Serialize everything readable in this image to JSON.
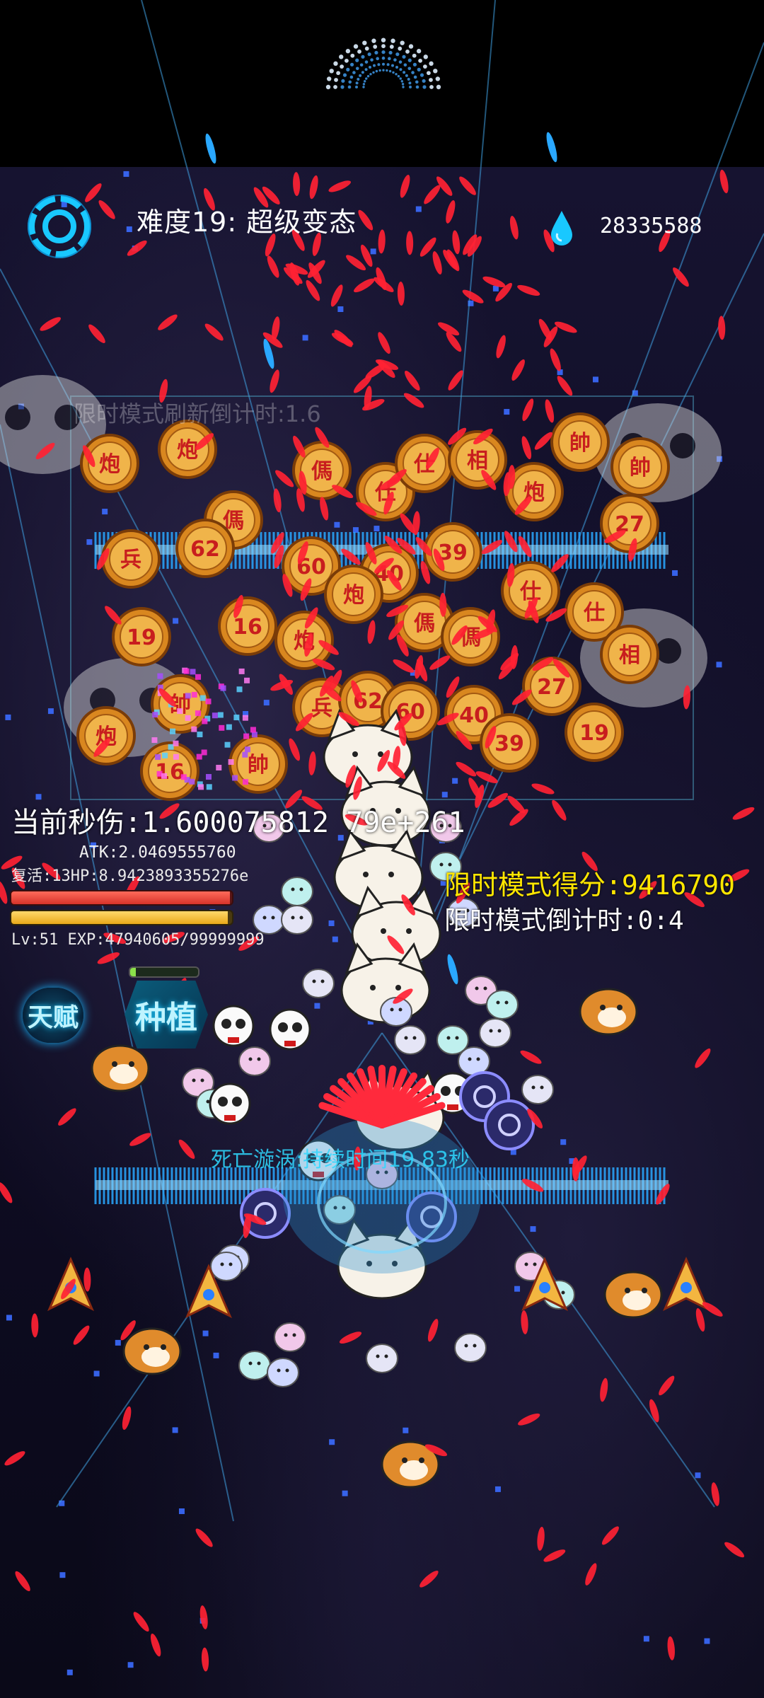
{
  "hud": {
    "difficulty": "难度19: 超级变态",
    "currency_value": "28335588",
    "refresh_countdown": "限时模式刷新倒计时:1.6",
    "dps": "当前秒伤:1.600075812      79e+261",
    "atk": "ATK:2.0469555760",
    "revive_hp": "复活:13HP:8.9423893355276e",
    "hp_fraction": 0.99,
    "exp_fraction": 0.98,
    "level_exp": "Lv:51   EXP:47940605/99999999",
    "score": "限时模式得分:9416790",
    "mode_countdown": "限时模式倒计时:0:4",
    "death_vortex": "死亡漩涡:持续时间19.83秒"
  },
  "buttons": {
    "talent": "天赋",
    "plant": "种植",
    "plant_cooldown_fraction": 0.08
  },
  "board_labels": [
    "炮",
    "炮",
    "傌",
    "傌",
    "仕",
    "仕",
    "相",
    "炮",
    "帥",
    "帥",
    "兵",
    "62",
    "60",
    "40",
    "39",
    "27",
    "19",
    "16"
  ],
  "icons": {
    "settings": "settings-gear-icon",
    "currency": "water-drop-icon"
  },
  "colors": {
    "bullet": "#ff2233",
    "laser": "#2aa8ff",
    "score": "#ffe600",
    "coin": "#d9871f"
  }
}
